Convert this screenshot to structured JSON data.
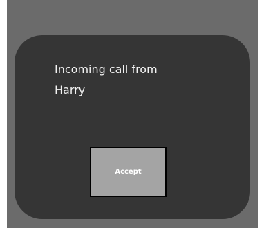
{
  "dialog": {
    "message_line1": "Incoming call from",
    "caller_name": "Harry",
    "accept_label": "Accept"
  },
  "colors": {
    "screen_background": "#6b6b6b",
    "dialog_background": "#353535",
    "button_background": "#a4a4a4",
    "text": "#f2f2f2"
  }
}
